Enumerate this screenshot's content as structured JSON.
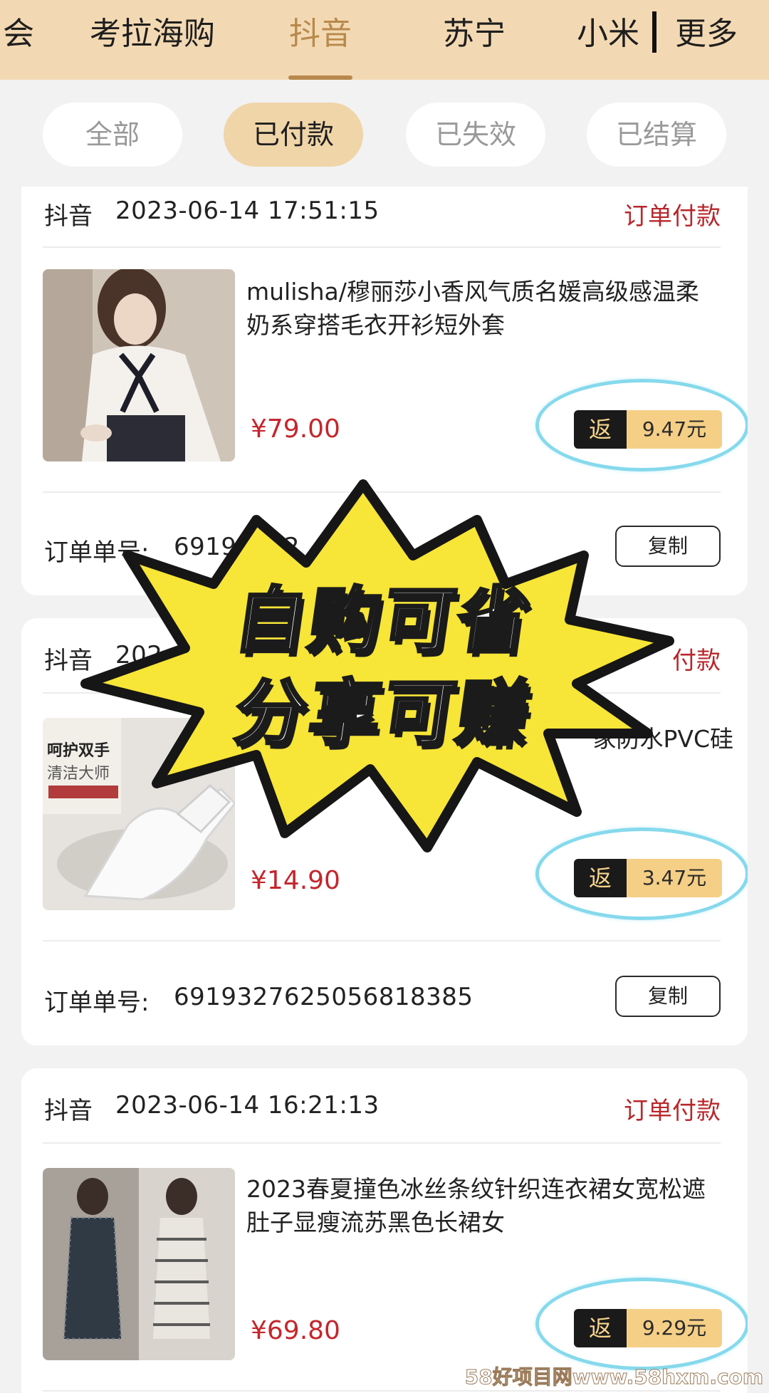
{
  "platform_tabs": [
    {
      "label": "会"
    },
    {
      "label": "考拉海购"
    },
    {
      "label": "抖音",
      "active": true
    },
    {
      "label": "苏宁"
    },
    {
      "label": "小米"
    },
    {
      "label": "更多"
    }
  ],
  "filters": [
    {
      "label": "全部"
    },
    {
      "label": "已付款",
      "active": true
    },
    {
      "label": "已失效"
    },
    {
      "label": "已结算"
    }
  ],
  "orders": [
    {
      "platform": "抖音",
      "time": "2023-06-14 17:51:15",
      "status": "订单付款",
      "title": "mulisha/穆丽莎小香风气质名媛高级感温柔奶系穿搭毛衣开衫短外套",
      "price": "¥79.00",
      "cashback_tag": "返",
      "cashback": "9.47元",
      "order_label": "订单单号:",
      "order_no": "69193362",
      "copy_label": "复制"
    },
    {
      "platform": "抖音",
      "time": "202",
      "status": "付款",
      "title": "家防水PVC硅",
      "price": "¥14.90",
      "cashback_tag": "返",
      "cashback": "3.47元",
      "order_label": "订单单号:",
      "order_no": "6919327625056818385",
      "copy_label": "复制",
      "image_text_1": "呵护双手",
      "image_text_2": "清洁大师"
    },
    {
      "platform": "抖音",
      "time": "2023-06-14 16:21:13",
      "status": "订单付款",
      "title": "2023春夏撞色冰丝条纹针织连衣裙女宽松遮肚子显瘦流苏黑色长裙女",
      "price": "¥69.80",
      "cashback_tag": "返",
      "cashback": "9.29元"
    }
  ],
  "promo": {
    "line1": "自购可省",
    "line2": "分享可赚"
  },
  "watermark": "58好项目网www.58hxm.com",
  "colors": {
    "topbar_bg": "#f3d9b3",
    "accent_gold": "#b8894c",
    "status_red": "#b8272b",
    "price_red": "#c4262c",
    "burst_yellow": "#f7e537"
  }
}
